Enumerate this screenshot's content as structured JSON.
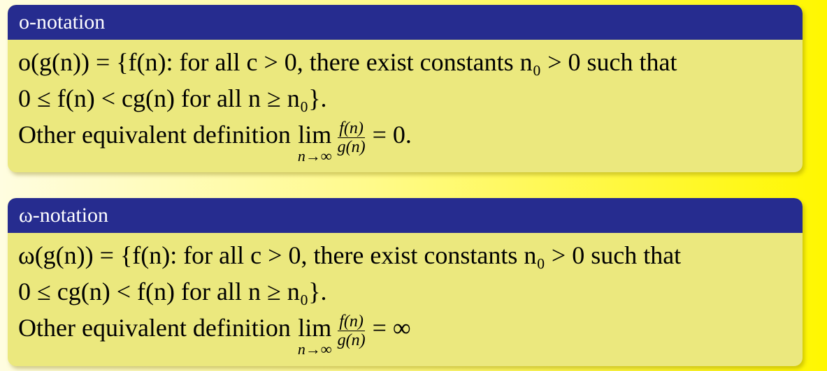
{
  "blocks": [
    {
      "title": "o-notation",
      "line1": "o(g(n)) = {f(n): for all c > 0, there exist constants n₀ > 0 such that",
      "line2": "0 ≤ f(n) < cg(n) for all n ≥ n₀}.",
      "line3_text": "Other equivalent definition",
      "lim_op": "lim",
      "lim_sub": "n→∞",
      "frac_num": "f(n)",
      "frac_den": "g(n)",
      "rhs": "= 0."
    },
    {
      "title": "ω-notation",
      "line1": "ω(g(n)) = {f(n): for all c > 0, there exist constants n₀ > 0 such that",
      "line2": "0 ≤ cg(n) < f(n) for all n ≥ n₀}.",
      "line3_text": "Other equivalent definition",
      "lim_op": "lim",
      "lim_sub": "n→∞",
      "frac_num": "f(n)",
      "frac_den": "g(n)",
      "rhs": "= ∞"
    }
  ],
  "colors": {
    "title_bar": "#262c8f",
    "block_body": "#ebe87e",
    "background_end": "#fff700"
  }
}
